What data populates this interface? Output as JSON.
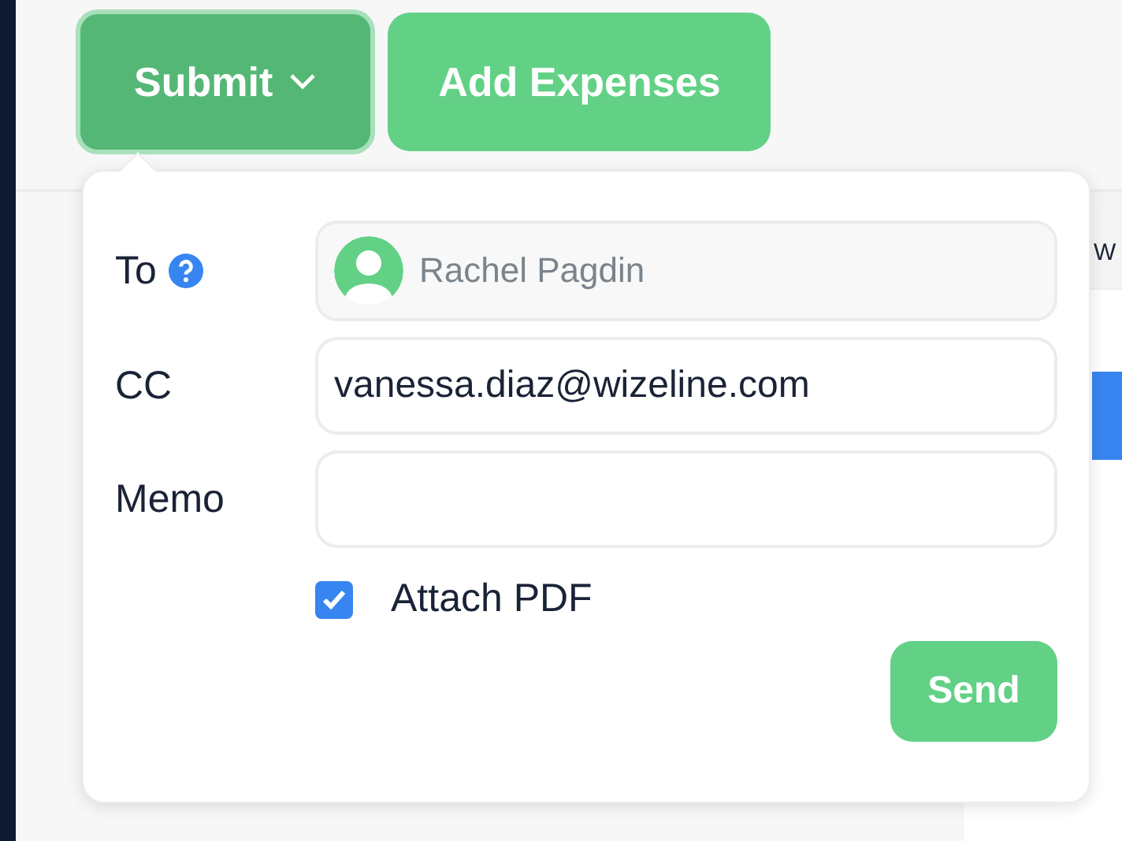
{
  "toolbar": {
    "buttons": [
      {
        "label": "Submit",
        "kind": "dropdown",
        "selected": true
      },
      {
        "label": "Add Expenses",
        "kind": "plain",
        "selected": false
      }
    ]
  },
  "background": {
    "side_text": "W"
  },
  "submit_popover": {
    "to": {
      "label": "To",
      "value": "Rachel Pagdin",
      "disabled": true
    },
    "cc": {
      "label": "CC",
      "value": "vanessa.diaz@wizeline.com"
    },
    "memo": {
      "label": "Memo"
    },
    "attach_pdf": {
      "label": "Attach PDF",
      "checked": true
    },
    "send_button": "Send"
  }
}
